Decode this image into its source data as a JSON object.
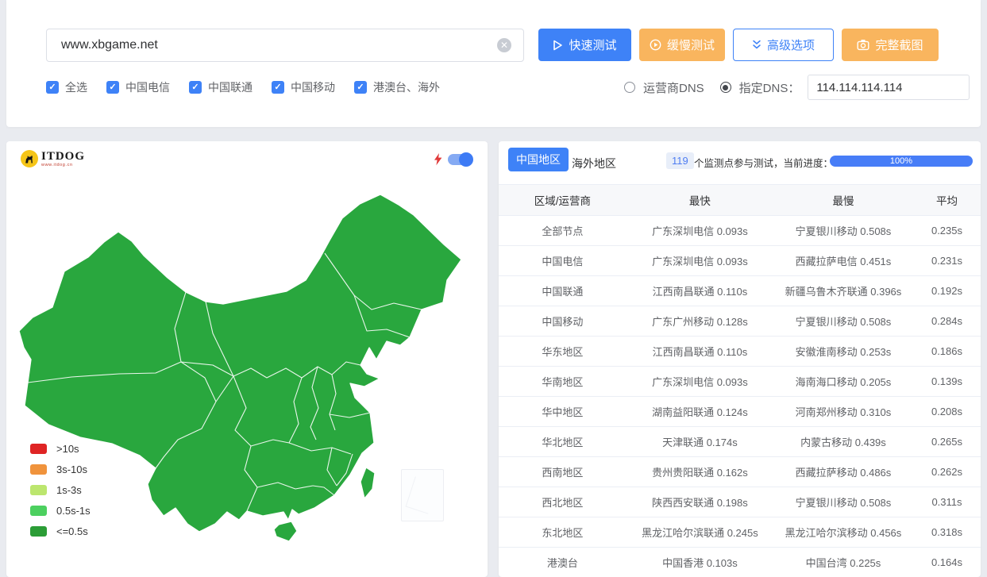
{
  "colors": {
    "accent_blue": "#3e82f7",
    "accent_orange": "#f9b55e",
    "progress_blue": "#477df7",
    "map_green": "#29a73e",
    "page_bg": "#e9ebf0"
  },
  "search": {
    "value": "www.xbgame.net"
  },
  "actions": {
    "quick": "快速测试",
    "slow": "缓慢测试",
    "advanced": "高级选项",
    "screenshot": "完整截图"
  },
  "filters": [
    {
      "label": "全选",
      "checked": true
    },
    {
      "label": "中国电信",
      "checked": true
    },
    {
      "label": "中国联通",
      "checked": true
    },
    {
      "label": "中国移动",
      "checked": true
    },
    {
      "label": "港澳台、海外",
      "checked": true
    }
  ],
  "dns": {
    "carrier_label": "运营商DNS",
    "carrier_selected": false,
    "custom_label": "指定DNS：",
    "custom_selected": true,
    "value": "114.114.114.114"
  },
  "map_panel": {
    "logo_title": "ITDOG",
    "logo_subtitle": "www.itdog.cn",
    "speed_toggle_on": true,
    "legend": [
      {
        "label": ">10s",
        "color": "#df2424"
      },
      {
        "label": "3s-10s",
        "color": "#f0933c"
      },
      {
        "label": "1s-3s",
        "color": "#bce66e"
      },
      {
        "label": "0.5s-1s",
        "color": "#4cd05f"
      },
      {
        "label": "<=0.5s",
        "color": "#2b9d36"
      }
    ]
  },
  "results_panel": {
    "tabs": [
      {
        "label": "中国地区",
        "active": true
      },
      {
        "label": "海外地区",
        "active": false
      }
    ],
    "monitor_count": "119",
    "progress_label": "个监测点参与测试，当前进度：",
    "progress_value": "100%",
    "table": {
      "headers": [
        "区域/运营商",
        "最快",
        "最慢",
        "平均"
      ],
      "rows": [
        [
          "全部节点",
          "广东深圳电信 0.093s",
          "宁夏银川移动 0.508s",
          "0.235s"
        ],
        [
          "中国电信",
          "广东深圳电信 0.093s",
          "西藏拉萨电信 0.451s",
          "0.231s"
        ],
        [
          "中国联通",
          "江西南昌联通 0.110s",
          "新疆乌鲁木齐联通 0.396s",
          "0.192s"
        ],
        [
          "中国移动",
          "广东广州移动 0.128s",
          "宁夏银川移动 0.508s",
          "0.284s"
        ],
        [
          "华东地区",
          "江西南昌联通 0.110s",
          "安徽淮南移动 0.253s",
          "0.186s"
        ],
        [
          "华南地区",
          "广东深圳电信 0.093s",
          "海南海口移动 0.205s",
          "0.139s"
        ],
        [
          "华中地区",
          "湖南益阳联通 0.124s",
          "河南郑州移动 0.310s",
          "0.208s"
        ],
        [
          "华北地区",
          "天津联通 0.174s",
          "内蒙古移动 0.439s",
          "0.265s"
        ],
        [
          "西南地区",
          "贵州贵阳联通 0.162s",
          "西藏拉萨移动 0.486s",
          "0.262s"
        ],
        [
          "西北地区",
          "陕西西安联通 0.198s",
          "宁夏银川移动 0.508s",
          "0.311s"
        ],
        [
          "东北地区",
          "黑龙江哈尔滨联通 0.245s",
          "黑龙江哈尔滨移动 0.456s",
          "0.318s"
        ],
        [
          "港澳台",
          "中国香港 0.103s",
          "中国台湾 0.225s",
          "0.164s"
        ]
      ]
    }
  }
}
